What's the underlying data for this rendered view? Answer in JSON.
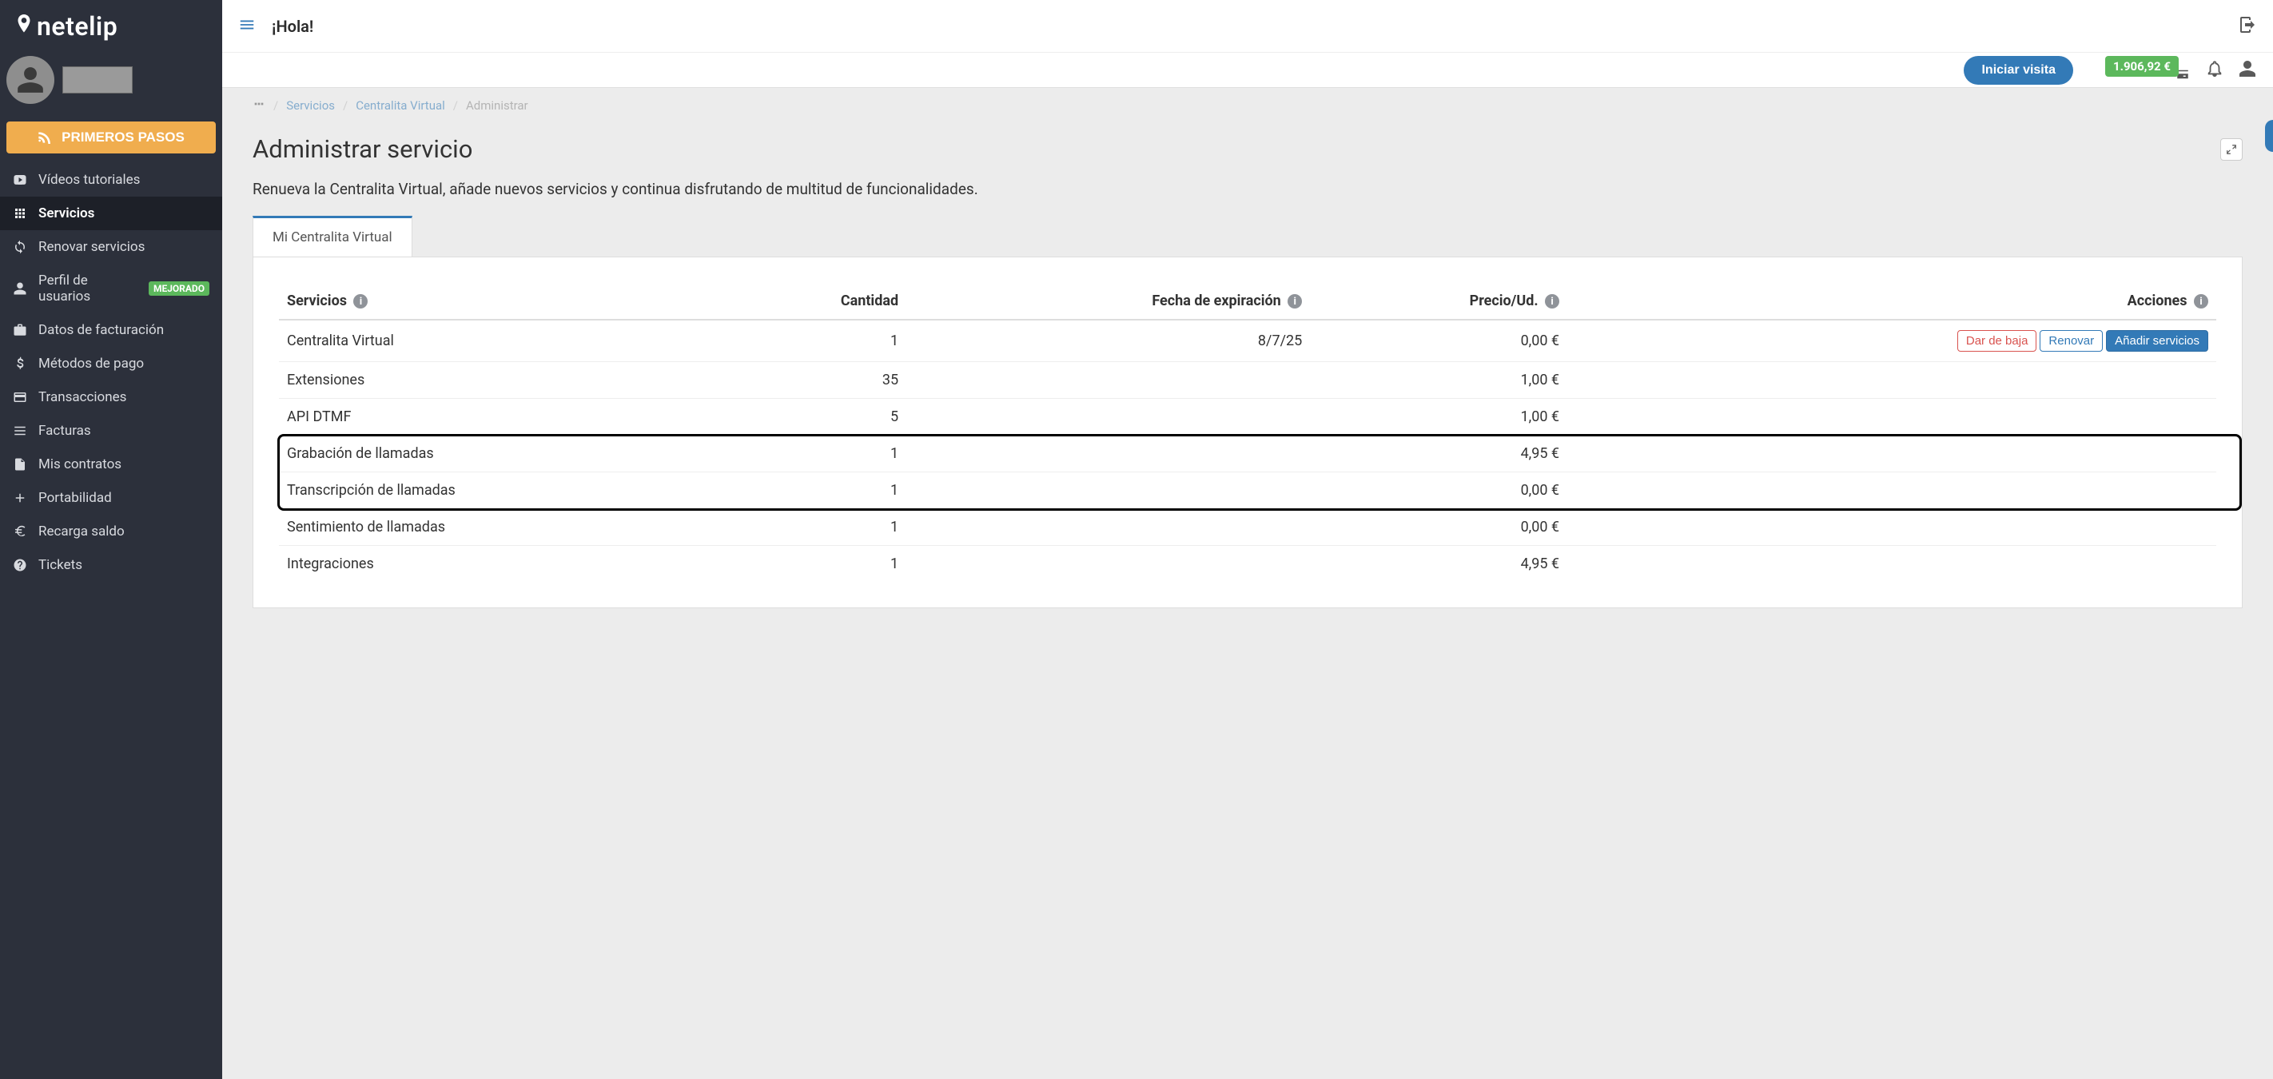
{
  "brand": "netelip",
  "sidebar": {
    "primary_button": "PRIMEROS PASOS",
    "items": [
      {
        "label": "Vídeos tutoriales"
      },
      {
        "label": "Servicios"
      },
      {
        "label": "Renovar servicios"
      },
      {
        "label": "Perfil de usuarios",
        "badge": "MEJORADO"
      },
      {
        "label": "Datos de facturación"
      },
      {
        "label": "Métodos de pago"
      },
      {
        "label": "Transacciones"
      },
      {
        "label": "Facturas"
      },
      {
        "label": "Mis contratos"
      },
      {
        "label": "Portabilidad"
      },
      {
        "label": "Recarga saldo"
      },
      {
        "label": "Tickets"
      }
    ]
  },
  "topbar": {
    "greeting": "¡Hola!",
    "visit_button": "Iniciar visita",
    "balance": "1.906,92 €"
  },
  "breadcrumb": {
    "servicios": "Servicios",
    "centralita": "Centralita Virtual",
    "administrar": "Administrar"
  },
  "page": {
    "title": "Administrar servicio",
    "subtitle": "Renueva la Centralita Virtual, añade nuevos servicios y continua disfrutando de multitud de funcionalidades.",
    "tab_label": "Mi Centralita Virtual"
  },
  "table": {
    "headers": {
      "servicios": "Servicios",
      "cantidad": "Cantidad",
      "fecha": "Fecha de expiración",
      "precio": "Precio/Ud.",
      "acciones": "Acciones"
    },
    "actions": {
      "baja": "Dar de baja",
      "renovar": "Renovar",
      "anadir": "Añadir servicios"
    },
    "rows": [
      {
        "name": "Centralita Virtual",
        "qty": "1",
        "exp": "8/7/25",
        "price": "0,00 €",
        "actions": true
      },
      {
        "name": "Extensiones",
        "qty": "35",
        "exp": "",
        "price": "1,00 €"
      },
      {
        "name": "API DTMF",
        "qty": "5",
        "exp": "",
        "price": "1,00 €"
      },
      {
        "name": "Grabación de llamadas",
        "qty": "1",
        "exp": "",
        "price": "4,95 €"
      },
      {
        "name": "Transcripción de llamadas",
        "qty": "1",
        "exp": "",
        "price": "0,00 €"
      },
      {
        "name": "Sentimiento de llamadas",
        "qty": "1",
        "exp": "",
        "price": "0,00 €"
      },
      {
        "name": "Integraciones",
        "qty": "1",
        "exp": "",
        "price": "4,95 €"
      }
    ]
  }
}
